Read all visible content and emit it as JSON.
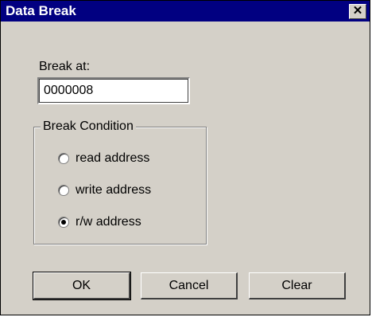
{
  "window": {
    "title": "Data Break",
    "close_glyph": "✕"
  },
  "break_at": {
    "label": "Break at:",
    "value": "0000008"
  },
  "break_condition": {
    "legend": "Break Condition",
    "options": [
      {
        "label": "read address",
        "checked": false
      },
      {
        "label": "write address",
        "checked": false
      },
      {
        "label": "r/w address",
        "checked": true
      }
    ]
  },
  "buttons": {
    "ok": "OK",
    "cancel": "Cancel",
    "clear": "Clear"
  }
}
